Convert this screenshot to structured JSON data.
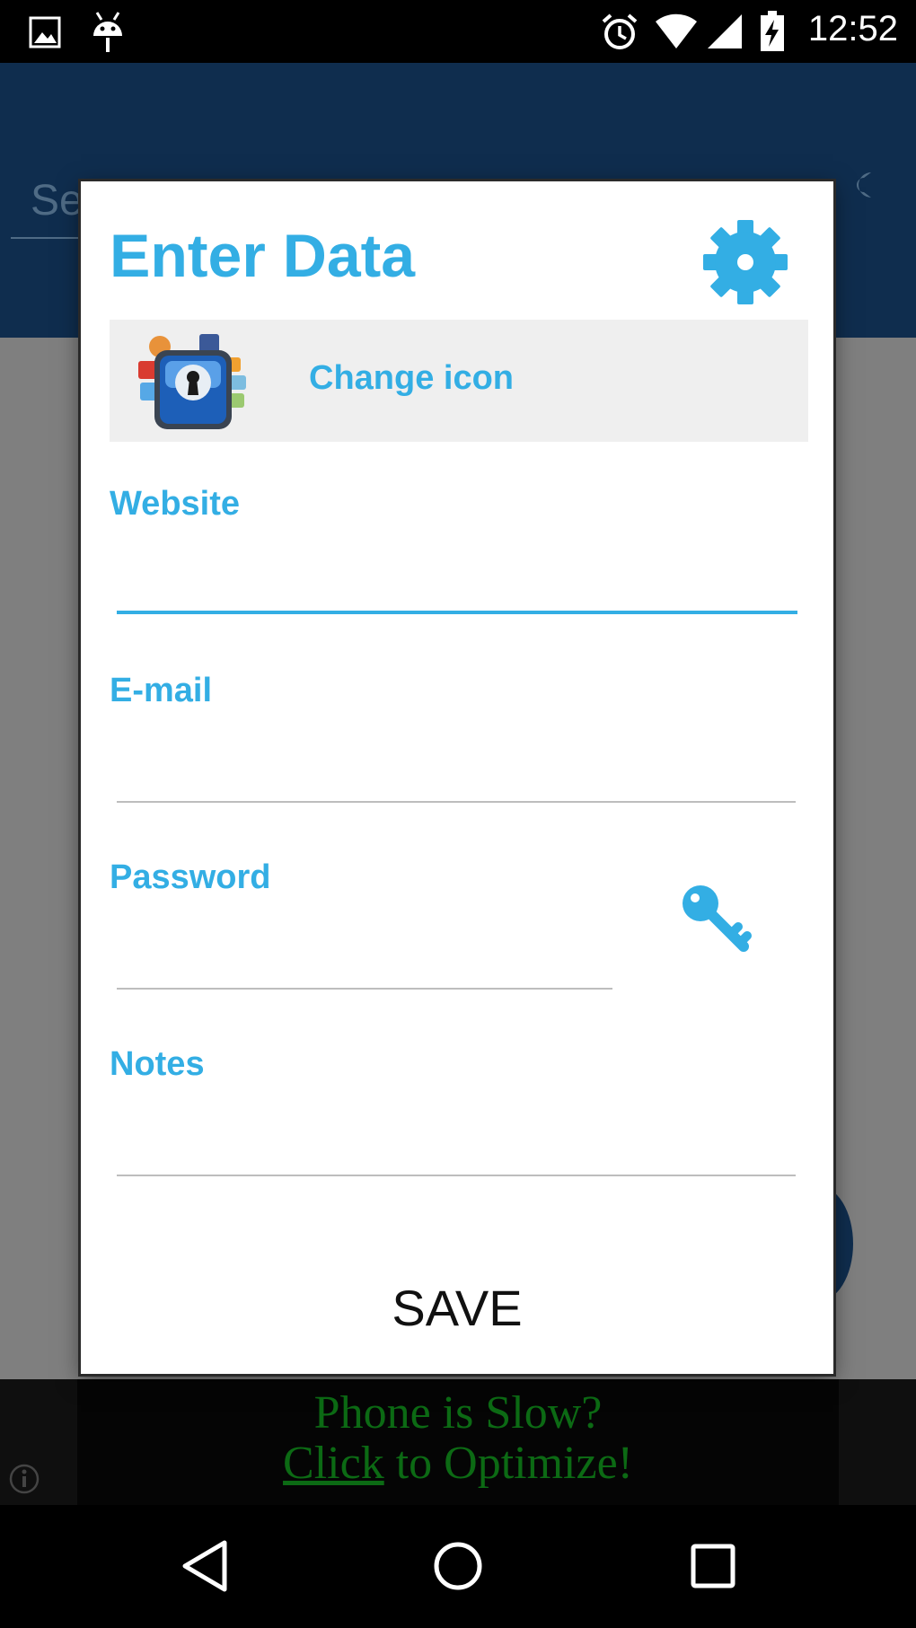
{
  "status_bar": {
    "time": "12:52",
    "icons": [
      "image-icon",
      "android-icon",
      "alarm-icon",
      "wifi-icon",
      "cell-signal-icon",
      "battery-charging-icon"
    ]
  },
  "background_app": {
    "search_placeholder_partial": "Se",
    "tool_icon": "wrench-icon"
  },
  "dialog": {
    "title": "Enter Data",
    "settings_icon": "gear-icon",
    "change_icon_label": "Change icon",
    "fields": [
      {
        "label": "Website",
        "value": ""
      },
      {
        "label": "E-mail",
        "value": ""
      },
      {
        "label": "Password",
        "value": ""
      },
      {
        "label": "Notes",
        "value": ""
      }
    ],
    "password_generator_icon": "key-icon",
    "save_label": "SAVE"
  },
  "ad": {
    "line1": "Phone is Slow?",
    "line2_link": "Click",
    "line2_rest": " to Optimize!"
  },
  "nav_bar": {
    "buttons": [
      "back-icon",
      "home-icon",
      "recents-icon"
    ]
  },
  "colors": {
    "accent": "#33aee4",
    "header": "#0f2d4e",
    "scrim": "#7f7f7f",
    "ad_text": "#0c6a14"
  }
}
